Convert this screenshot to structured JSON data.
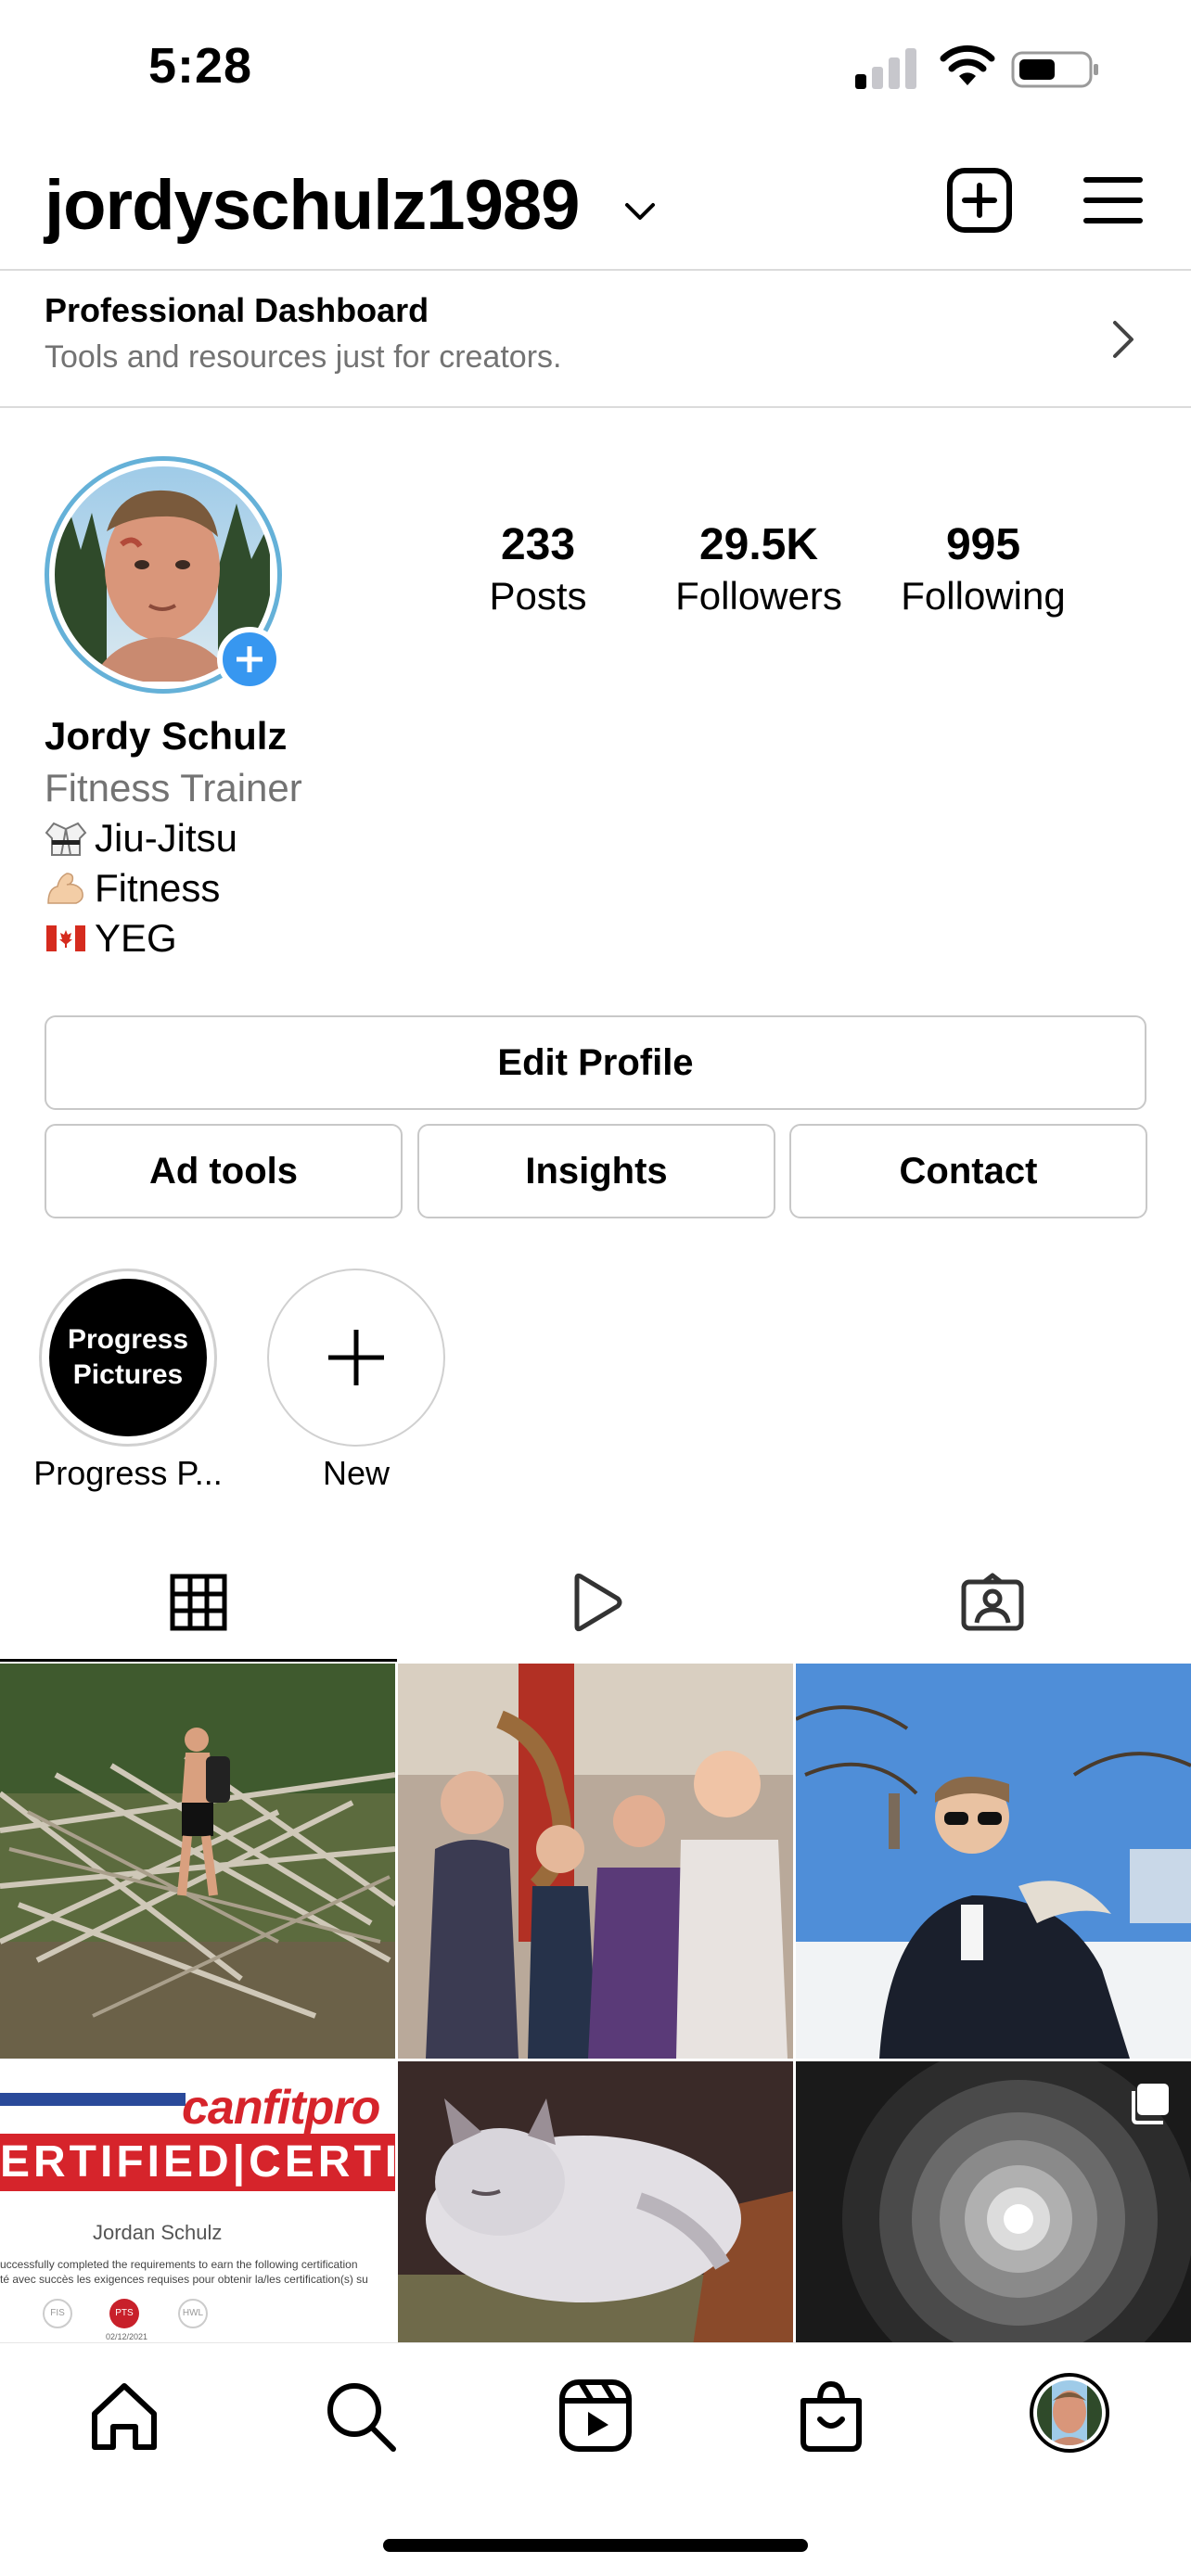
{
  "status_bar": {
    "time": "5:28",
    "signal_icon": "signal-icon",
    "wifi_icon": "wifi-icon",
    "battery_icon": "battery-icon"
  },
  "header": {
    "username": "jordyschulz1989",
    "account_switch_icon": "chevron-down-icon",
    "new_post_icon": "plus-square-icon",
    "menu_icon": "hamburger-menu-icon"
  },
  "professional_dashboard": {
    "title": "Professional Dashboard",
    "subtitle": "Tools and resources just for creators.",
    "chevron_icon": "chevron-right-icon"
  },
  "profile": {
    "display_name": "Jordy Schulz",
    "category": "Fitness Trainer",
    "bio": [
      {
        "emoji": "martial-arts-uniform",
        "text": "Jiu-Jitsu"
      },
      {
        "emoji": "flexed-biceps",
        "text": "Fitness"
      },
      {
        "emoji": "canada-flag",
        "text": "YEG"
      }
    ],
    "stats": {
      "posts": {
        "value": "233",
        "label": "Posts"
      },
      "followers": {
        "value": "29.5K",
        "label": "Followers"
      },
      "following": {
        "value": "995",
        "label": "Following"
      }
    }
  },
  "buttons": {
    "edit_profile": "Edit Profile",
    "ad_tools": "Ad tools",
    "insights": "Insights",
    "contact": "Contact"
  },
  "highlights": [
    {
      "cover_text_line1": "Progress",
      "cover_text_line2": "Pictures",
      "label": "Progress P..."
    },
    {
      "label": "New",
      "icon": "plus-icon"
    }
  ],
  "tabs": [
    {
      "name": "posts-grid",
      "icon": "grid-icon",
      "active": true
    },
    {
      "name": "reels",
      "icon": "play-icon",
      "active": false
    },
    {
      "name": "tagged",
      "icon": "person-tag-icon",
      "active": false
    }
  ],
  "grid_posts": [
    {
      "subject": "hiker crossing fallen branches"
    },
    {
      "subject": "family photo"
    },
    {
      "subject": "man in winter jacket"
    },
    {
      "subject": "certificate",
      "brand": "canfitpro",
      "banner": "ERTIFIED|CERTIFI",
      "name": "Jordan Schulz",
      "text1": "uccessfully completed the requirements to earn the following certification",
      "text2": "té avec succès les exigences requises pour obtenir la/les certification(s) su",
      "badges": [
        "FIS",
        "PTS",
        "HWL"
      ],
      "date": "02/12/2021"
    },
    {
      "subject": "sleeping cat"
    },
    {
      "subject": "tunnel",
      "multi_post": true
    }
  ],
  "bottom_nav": [
    "home-icon",
    "search-icon",
    "reels-icon",
    "shop-icon",
    "profile-avatar"
  ],
  "colors": {
    "accent_blue": "#3797f0",
    "avatar_ring": "#65b1d8",
    "divider": "#dbdbdb",
    "secondary_text": "#737373"
  }
}
